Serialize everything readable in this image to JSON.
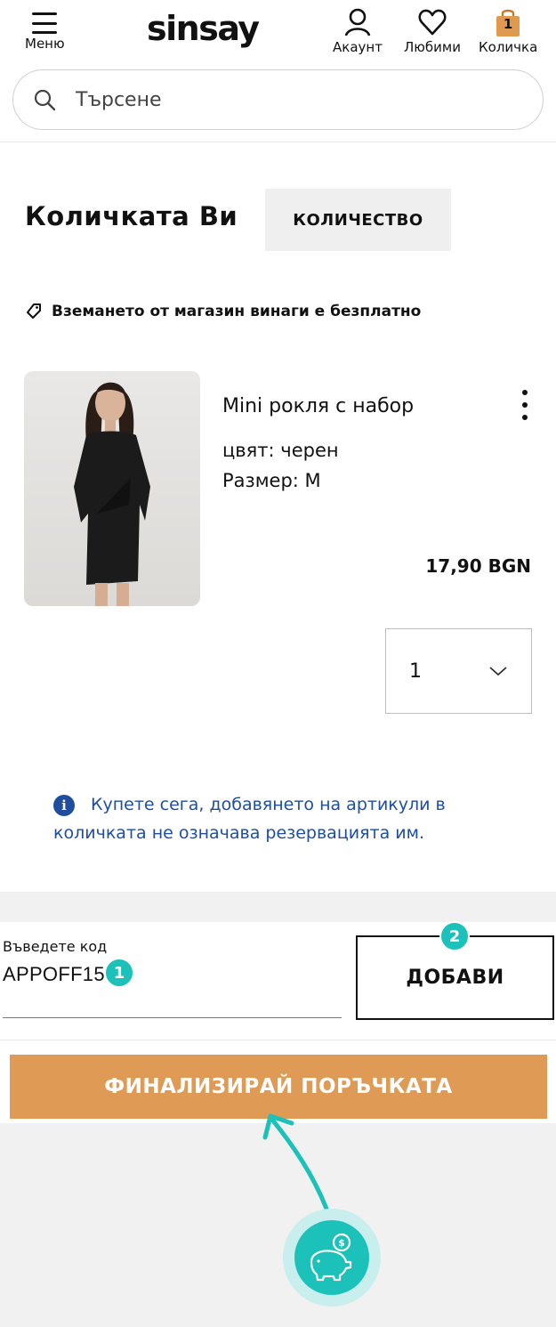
{
  "header": {
    "menu_label": "Меню",
    "logo": "sinsay",
    "account_label": "Акаунт",
    "favorites_label": "Любими",
    "cart_label": "Количка",
    "cart_count": "1"
  },
  "search": {
    "placeholder": "Търсене"
  },
  "cart": {
    "title": "Количката Ви",
    "quantity_tab": "КОЛИЧЕСТВО",
    "pickup_note": "Вземането от магазин винаги е безплатно"
  },
  "product": {
    "name": "Mini рокля с набор",
    "color": "цвят: черен",
    "size": "Размер: M",
    "price": "17,90 BGN",
    "quantity": "1"
  },
  "info": {
    "icon": "i",
    "text": "Купете сега, добавянето на артикули в количката не означава резервацията им."
  },
  "voucher": {
    "label": "Въведете код",
    "value": "APPOFF15",
    "add_label": "ДОБАВИ"
  },
  "badges": {
    "first": "1",
    "second": "2"
  },
  "checkout": {
    "label": "ФИНАЛИЗИРАЙ ПОРЪЧКАТА"
  },
  "colors": {
    "accent_orange": "#df9a56",
    "teal": "#1cc1b9",
    "info_blue": "#1f4ea0",
    "gray_bg": "#f1f1f1"
  },
  "icons": [
    "menu-icon",
    "user-icon",
    "heart-icon",
    "shopping-bag-icon",
    "search-icon",
    "tag-icon",
    "chevron-down-icon",
    "info-icon",
    "kebab-icon",
    "piggy-bank-icon",
    "arrow-icon"
  ]
}
